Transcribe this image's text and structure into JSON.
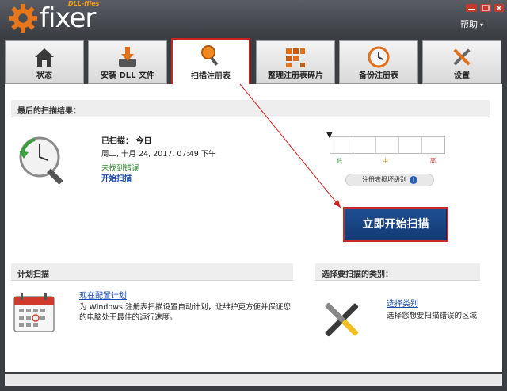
{
  "app": {
    "logo_text": "fixer",
    "logo_sub": "DLL-files",
    "help_label": "帮助",
    "help_caret": "▾"
  },
  "tabs": [
    {
      "label": "状态",
      "icon": "home-icon",
      "active": false
    },
    {
      "label": "安装 DLL 文件",
      "icon": "install-icon",
      "active": false
    },
    {
      "label": "扫描注册表",
      "icon": "magnifier-icon",
      "active": true
    },
    {
      "label": "整理注册表碎片",
      "icon": "defrag-icon",
      "active": false
    },
    {
      "label": "备份注册表",
      "icon": "backup-clock-icon",
      "active": false
    },
    {
      "label": "设置",
      "icon": "tools-icon",
      "active": false
    }
  ],
  "last_scan": {
    "section_title": "最后的扫描结果：",
    "scanned_label": "已扫描： 今日",
    "scan_date": "周二, 十月 24, 2017. 07:49 下午",
    "status": "未找到错误",
    "start_link": "开始扫描"
  },
  "meter": {
    "low": "低",
    "mid": "中",
    "high": "高",
    "level_label": "注册表损坏级别",
    "info_glyph": "i"
  },
  "scan_button": "立即开始扫描",
  "schedule": {
    "section_title": "计划扫描",
    "config_link": "现在配置计划",
    "description": "为 Windows 注册表扫描设置自动计划，让维护更方便并保证您的电脑处于最佳的运行速度。"
  },
  "categories": {
    "section_title": "选择要扫描的类别：",
    "select_link": "选择类别",
    "description": "选择您想要扫描错误的区域"
  },
  "colors": {
    "accent_red": "#d02020",
    "button_blue": "#1f4f93",
    "link_blue": "#1a4cb0",
    "ok_green": "#2a8a2a"
  }
}
